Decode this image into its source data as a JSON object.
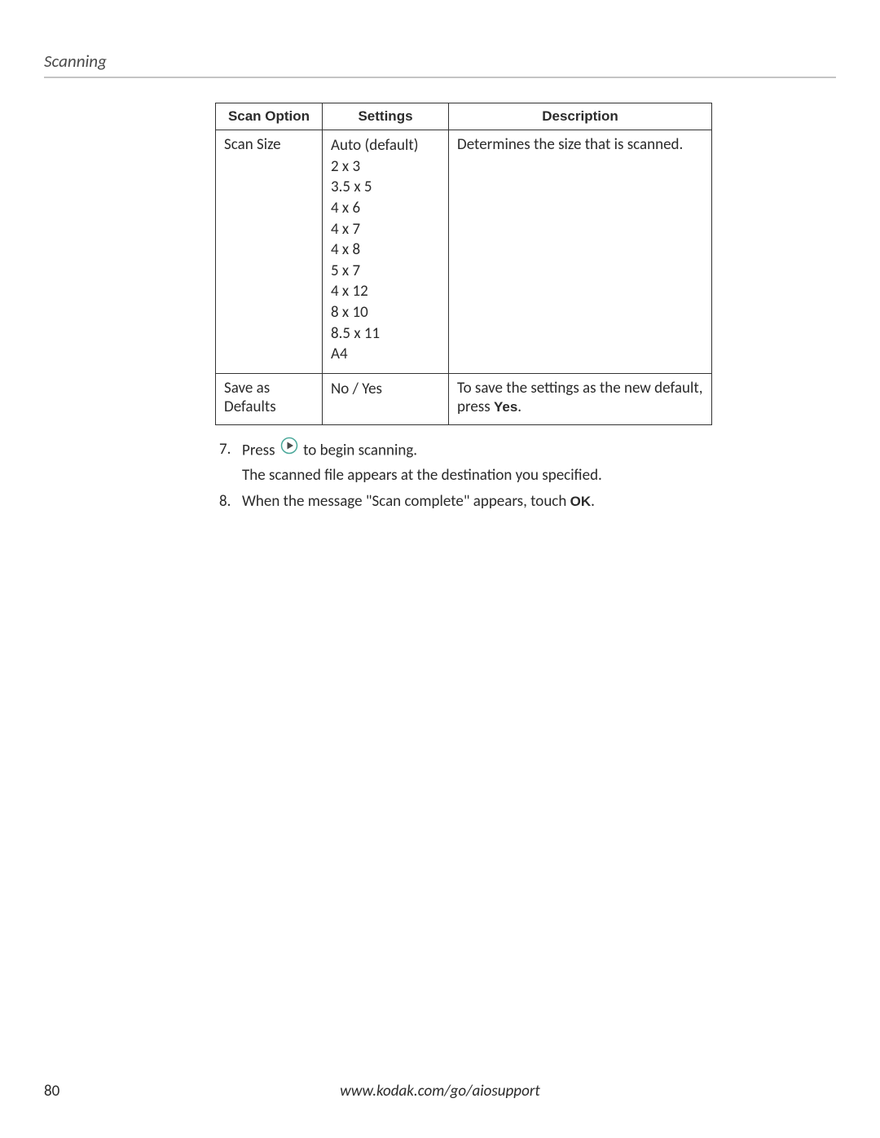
{
  "header": {
    "title": "Scanning"
  },
  "table": {
    "headers": {
      "option": "Scan Option",
      "settings": "Settings",
      "description": "Description"
    },
    "rows": [
      {
        "option": "Scan Size",
        "settings": [
          "Auto (default)",
          "2 x 3",
          "3.5 x 5",
          "4 x 6",
          "4 x 7",
          "4 x 8",
          "5 x 7",
          "4 x 12",
          "8 x 10",
          "8.5 x 11",
          "A4"
        ],
        "description": "Determines the size that is scanned."
      },
      {
        "option": "Save as Defaults",
        "settings": [
          "No / Yes"
        ],
        "description_prefix": "To save the settings as the new default, press ",
        "description_bold": "Yes",
        "description_suffix": "."
      }
    ]
  },
  "steps": {
    "items": [
      {
        "number": "7.",
        "line1_prefix": "Press ",
        "line1_suffix": " to begin scanning.",
        "line2": "The scanned file appears at the destination you specified."
      },
      {
        "number": "8.",
        "line1_prefix": "When the message \"Scan complete\" appears, touch ",
        "line1_bold": "OK",
        "line1_suffix": "."
      }
    ]
  },
  "footer": {
    "page_number": "80",
    "url": "www.kodak.com/go/aiosupport"
  }
}
